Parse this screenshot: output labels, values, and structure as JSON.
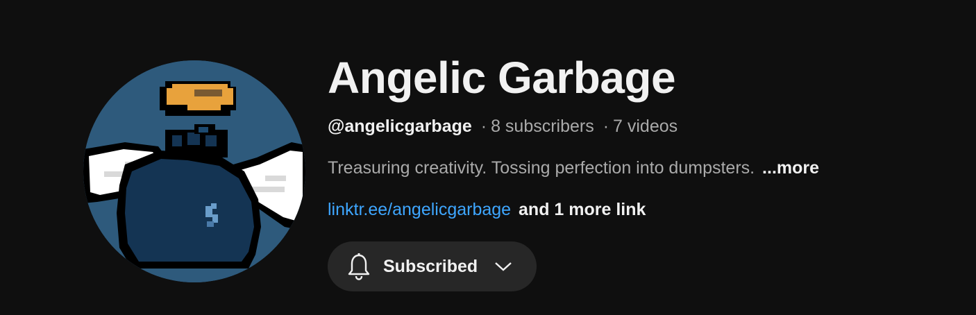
{
  "channel": {
    "name": "Angelic Garbage",
    "handle": "@angelicgarbage",
    "separator": "·",
    "subscribers": "8 subscribers",
    "videos": "7 videos",
    "description": "Treasuring creativity. Tossing perfection into dumpsters.",
    "more_label": "...more",
    "primary_link": "linktr.ee/angelicgarbage",
    "more_links_label": "and 1 more link",
    "avatar_icon": "pixel-angel-garbage-bag-icon"
  },
  "subscribe": {
    "label": "Subscribed",
    "bell_icon": "bell-icon",
    "chevron_icon": "chevron-down-icon"
  },
  "colors": {
    "background": "#0f0f0f",
    "text_primary": "#f1f1f1",
    "text_secondary": "#aaaaaa",
    "link": "#3ea6ff",
    "button_bg": "#272727",
    "avatar_bg": "#2e5a7c",
    "bag": "#143453",
    "halo": "#e8a23c"
  }
}
